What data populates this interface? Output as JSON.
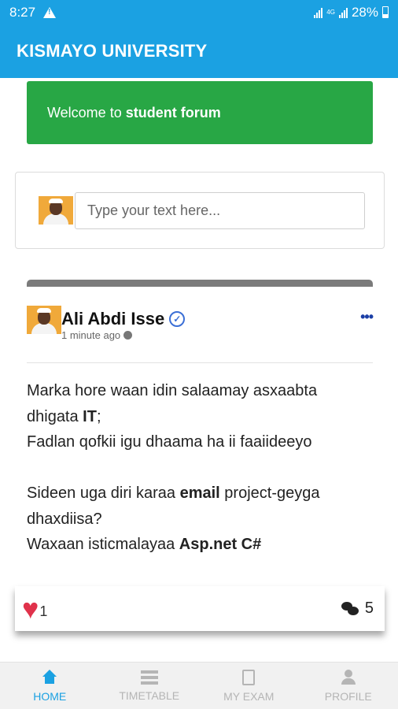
{
  "status": {
    "time": "8:27",
    "network": "4G",
    "battery": "28%"
  },
  "app": {
    "title": "KISMAYO UNIVERSITY"
  },
  "welcome": {
    "prefix": "Welcome to",
    "bold": "student forum"
  },
  "composer": {
    "placeholder": "Type your text here..."
  },
  "post": {
    "author": "Ali Abdi Isse",
    "time": "1 minute ago",
    "lines": [
      {
        "text": "Marka hore waan idin salaamay asxaabta",
        "bold": ""
      },
      {
        "text": "dhigata ",
        "bold": "IT",
        "after": ";"
      },
      {
        "text": "Fadlan qofkii igu dhaama ha ii faaiideeyo",
        "bold": ""
      },
      {
        "text": "Sideen uga diri karaa ",
        "bold": "email",
        "after": " project-geyga"
      },
      {
        "text": "dhaxdiisa?",
        "bold": ""
      },
      {
        "text": "Waxaan isticmalayaa ",
        "bold": "Asp.net C#"
      }
    ],
    "likes": "1",
    "comments": "5"
  },
  "nav": [
    {
      "label": "HOME",
      "icon": "home-icon",
      "active": true
    },
    {
      "label": "TIMETABLE",
      "icon": "timetable-icon",
      "active": false
    },
    {
      "label": "MY EXAM",
      "icon": "exam-icon",
      "active": false
    },
    {
      "label": "PROFILE",
      "icon": "profile-icon",
      "active": false
    }
  ],
  "colors": {
    "primary": "#1ba1e2",
    "success": "#28a745",
    "heart": "#e0324b"
  }
}
